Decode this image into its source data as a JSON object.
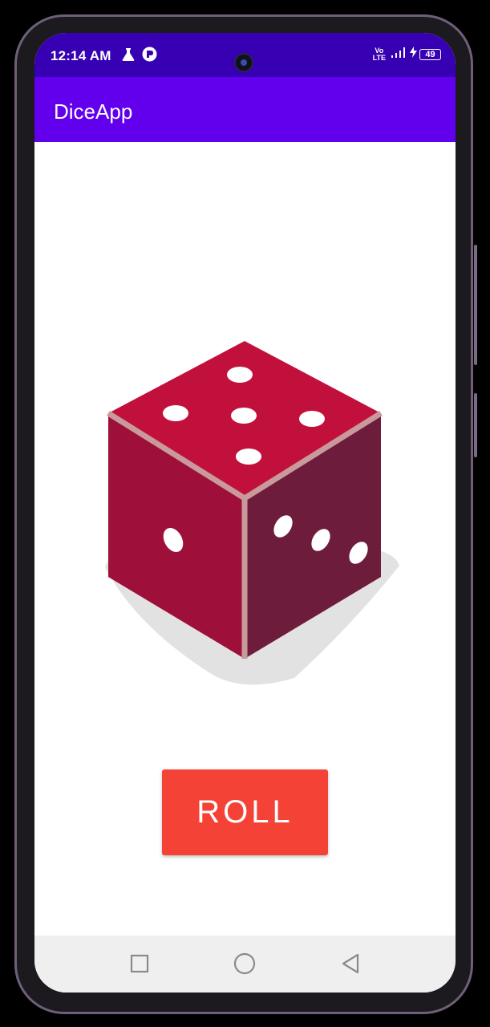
{
  "status_bar": {
    "time": "12:14 AM",
    "volte_line1": "Vo",
    "volte_line2": "LTE",
    "battery": "49",
    "left_icons": [
      "flask-icon",
      "app-notification-icon"
    ],
    "right_icons": [
      "volte-icon",
      "signal-icon",
      "charging-icon",
      "battery-icon"
    ],
    "color": "#3700b3"
  },
  "app_bar": {
    "title": "DiceApp",
    "color": "#6200ee"
  },
  "dice": {
    "top_face_pips": 5,
    "left_face_pips": 1,
    "right_face_pips": 3,
    "colors": {
      "top": "#c2103c",
      "left": "#9e0f3a",
      "right": "#6e1c3c",
      "edge": "#c99a9c",
      "shadow": "#e2e2e2"
    }
  },
  "roll_button": {
    "label": "ROLL",
    "color": "#f44336"
  },
  "nav_bar": {
    "buttons": [
      "recents-icon",
      "home-icon",
      "back-icon"
    ]
  }
}
